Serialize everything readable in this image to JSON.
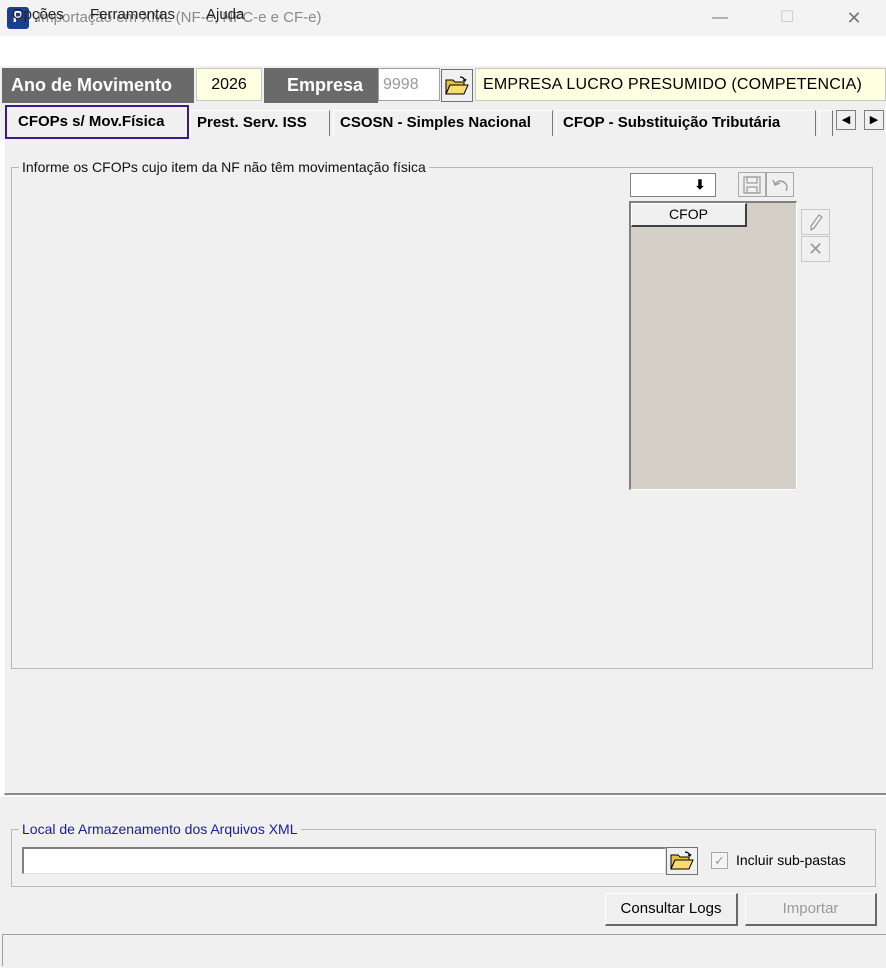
{
  "window": {
    "title": "Importação em XML (NF-e, NFC-e e CF-e)",
    "app_icon_letter": "P",
    "minimize_glyph": "—",
    "maximize_glyph": "☐",
    "close_glyph": "✕"
  },
  "menu": {
    "items": [
      {
        "label": "Opções"
      },
      {
        "label": "Ferramentas"
      },
      {
        "label": "Ajuda"
      }
    ]
  },
  "header": {
    "ano_label": "Ano de Movimento",
    "ano_value": "2026",
    "empresa_label": "Empresa",
    "empresa_code": "9998",
    "empresa_name": "EMPRESA LUCRO PRESUMIDO (COMPETENCIA)"
  },
  "tabs": [
    {
      "label": "CFOPs s/ Mov.Física",
      "active": true
    },
    {
      "label": "Prest. Serv. ISS"
    },
    {
      "label": "CSOSN - Simples Nacional"
    },
    {
      "label": "CFOP - Substituição Tributária"
    }
  ],
  "tab_scroll": {
    "left_glyph": "◀",
    "right_glyph": "▶"
  },
  "cfop_panel": {
    "group_label": "Informe os CFOPs cujo item da NF não têm movimentação física",
    "combo_value": "",
    "combo_arrow_glyph": "⬇",
    "grid_header": "CFOP",
    "delete_glyph": "✕"
  },
  "local": {
    "group_label": "Local de Armazenamento dos Arquivos XML",
    "path_value": "",
    "include_subfolders_label": "Incluir sub-pastas",
    "include_subfolders_checked": true,
    "check_glyph": "✓"
  },
  "buttons": {
    "consultar_logs": "Consultar Logs",
    "importar": "Importar"
  },
  "colors": {
    "header_label_bg": "#6a6a6a",
    "highlight_field_bg": "#ffffe1",
    "active_tab_border": "#3c1c7e",
    "group_label_accent": "#1c1c9c",
    "grid_bg": "#d4d0c8"
  }
}
